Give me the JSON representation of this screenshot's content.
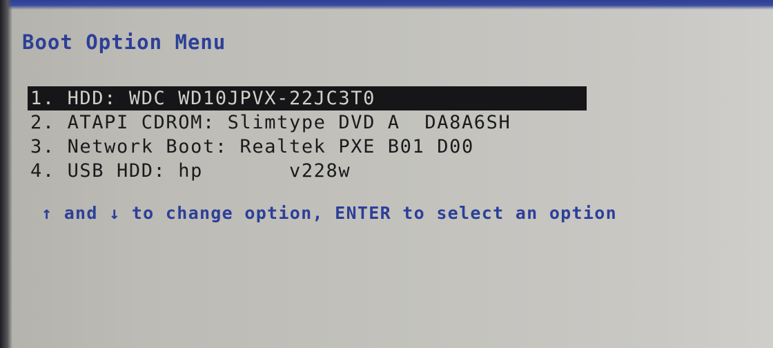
{
  "menu": {
    "title": "Boot Option Menu",
    "selected_index": 0,
    "options": [
      {
        "label": "1. HDD: WDC WD10JPVX-22JC3T0"
      },
      {
        "label": "2. ATAPI CDROM: Slimtype DVD A  DA8A6SH"
      },
      {
        "label": "3. Network Boot: Realtek PXE B01 D00"
      },
      {
        "label": "4. USB HDD: hp       v228w"
      }
    ]
  },
  "help": {
    "up_arrow": "↑",
    "and_text": " and ",
    "down_arrow": "↓",
    "rest_text": " to change option, ENTER to select an option"
  },
  "colors": {
    "screen_background": "#c3c2bd",
    "title_text": "#2c3f98",
    "option_text": "#1a1a1c",
    "selection_background": "#161618",
    "selection_text": "#cfcfcb"
  }
}
